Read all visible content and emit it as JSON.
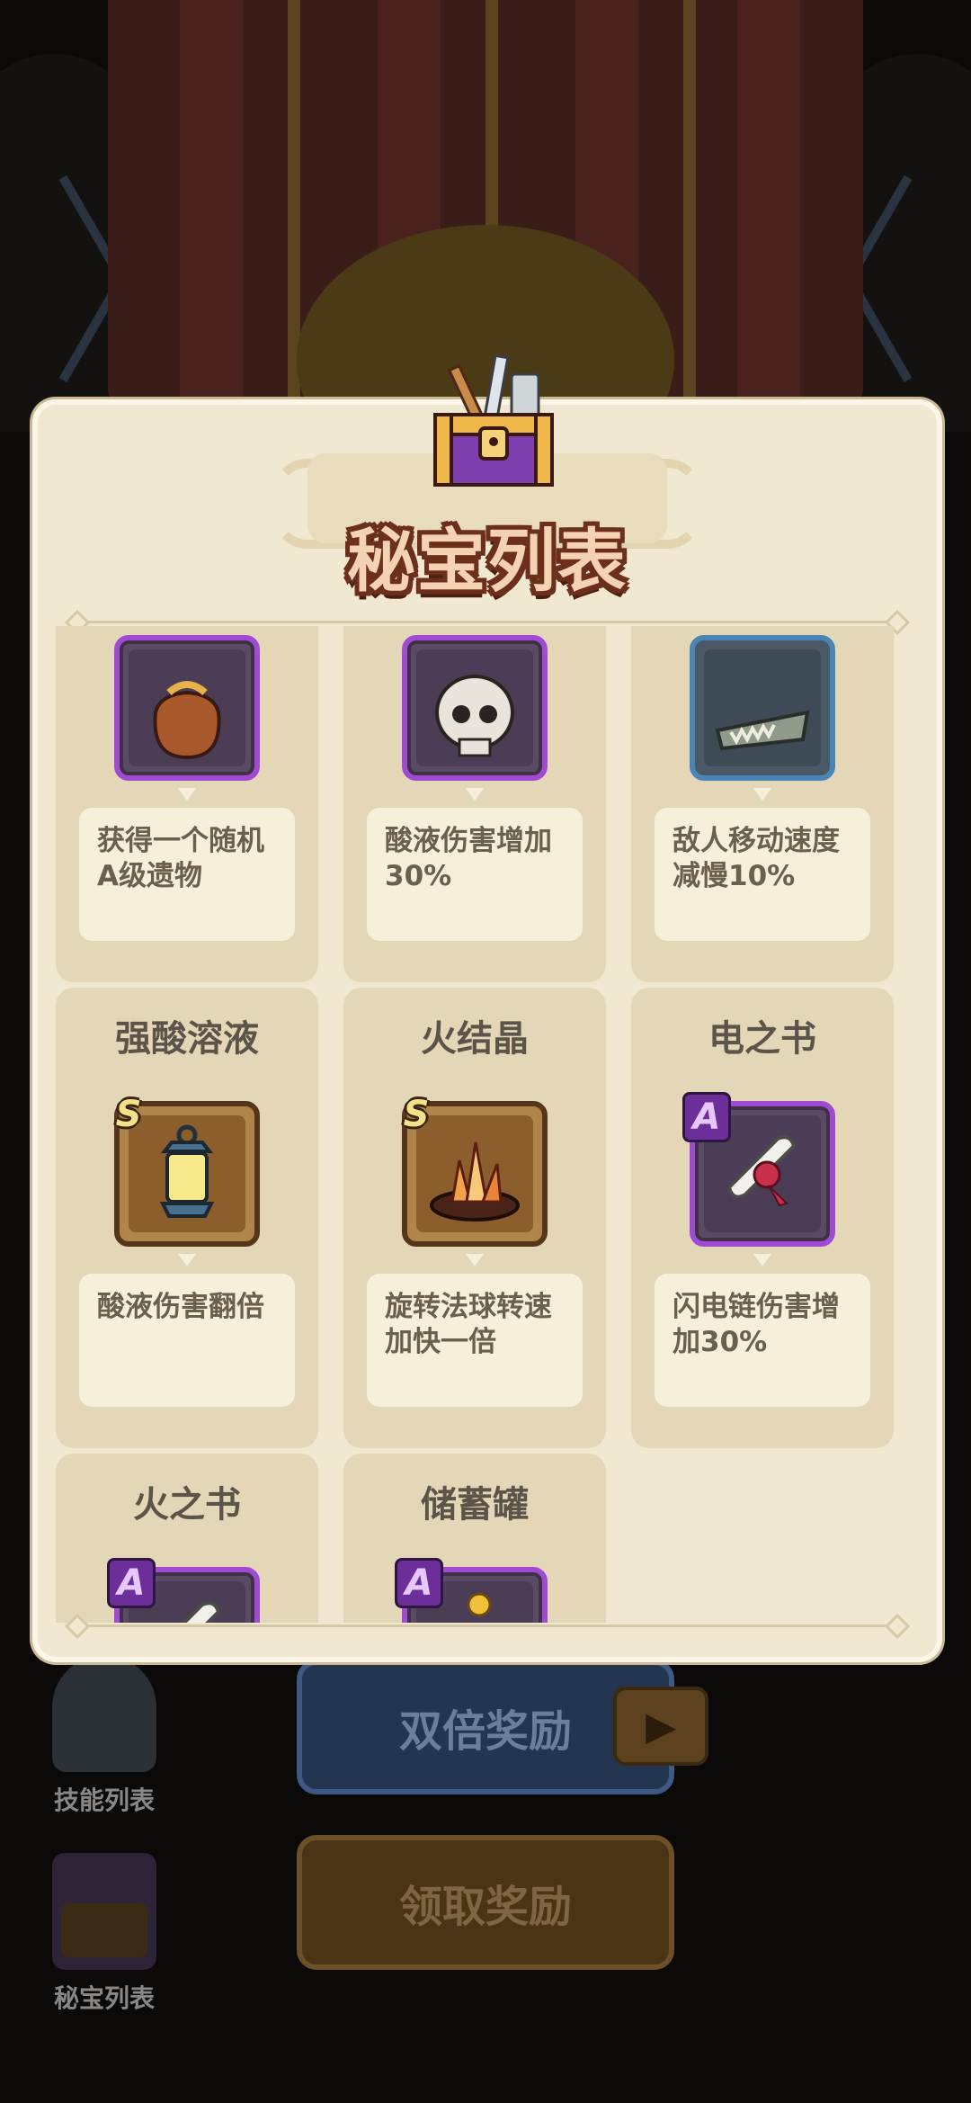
{
  "modal": {
    "title": "秘宝列表",
    "items": [
      {
        "name": "",
        "grade": "",
        "rarity": "A",
        "icon": "loot-bag-icon",
        "desc": "获得一个随机A级遗物"
      },
      {
        "name": "",
        "grade": "",
        "rarity": "A",
        "icon": "skull-icon",
        "desc": "酸液伤害增加30%"
      },
      {
        "name": "",
        "grade": "",
        "rarity": "B",
        "icon": "dragon-jaw-icon",
        "desc": "敌人移动速度减慢10%"
      },
      {
        "name": "强酸溶液",
        "grade": "S",
        "rarity": "S",
        "icon": "lantern-icon",
        "desc": "酸液伤害翻倍"
      },
      {
        "name": "火结晶",
        "grade": "S",
        "rarity": "S",
        "icon": "fire-crystal-icon",
        "desc": "旋转法球转速加快一倍"
      },
      {
        "name": "电之书",
        "grade": "A",
        "rarity": "A",
        "icon": "scroll-icon",
        "desc": "闪电链伤害增加30%"
      },
      {
        "name": "火之书",
        "grade": "A",
        "rarity": "A",
        "icon": "scroll-icon",
        "desc": ""
      },
      {
        "name": "储蓄罐",
        "grade": "A",
        "rarity": "A",
        "icon": "piggy-bank-icon",
        "desc": ""
      }
    ]
  },
  "background": {
    "skill_list_label": "技能列表",
    "treasure_list_label": "秘宝列表",
    "double_reward_label": "双倍奖励",
    "claim_reward_label": "领取奖励"
  },
  "colors": {
    "modal_bg": "#f1e8d1",
    "card_bg": "#e4d7b8",
    "grade_S": "#b08549",
    "grade_A": "#a14ad3",
    "grade_B": "#4b85b8",
    "title_outline": "#6b2f1c"
  }
}
